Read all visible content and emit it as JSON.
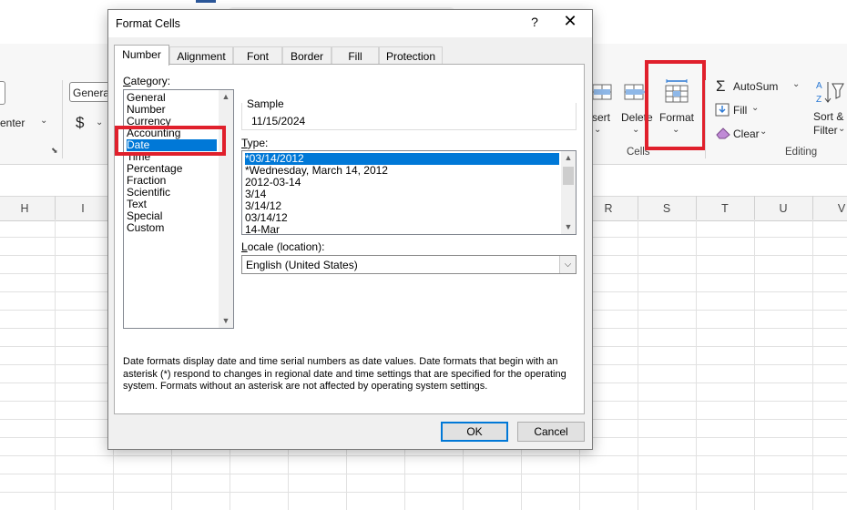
{
  "ribbon": {
    "font_dropdown_value": "Genera",
    "center_label": "enter",
    "currency_symbol": "$",
    "insert_label": "sert",
    "delete_label": "Delete",
    "format_label": "Format",
    "cells_group_label": "Cells",
    "autosum_label": "AutoSum",
    "fill_label": "Fill",
    "clear_label": "Clear",
    "sort_filter_line1": "Sort &",
    "sort_filter_line2": "Filter",
    "editing_group_label": "Editing",
    "partial_o": "o"
  },
  "columns": {
    "left": [
      "H",
      "I"
    ],
    "right": [
      "R",
      "S",
      "T",
      "U",
      "V"
    ]
  },
  "dialog": {
    "title": "Format Cells",
    "help_glyph": "?",
    "close_glyph": "✕",
    "tabs": [
      "Number",
      "Alignment",
      "Font",
      "Border",
      "Fill",
      "Protection"
    ],
    "active_tab": "Number",
    "category_label_accel": "C",
    "category_label_rest": "ategory:",
    "categories": [
      "General",
      "Number",
      "Currency",
      "Accounting",
      "Date",
      "Time",
      "Percentage",
      "Fraction",
      "Scientific",
      "Text",
      "Special",
      "Custom"
    ],
    "selected_category": "Date",
    "sample_label": "Sample",
    "sample_value": "11/15/2024",
    "type_label_accel": "T",
    "type_label_rest": "ype:",
    "types": [
      "*03/14/2012",
      "*Wednesday, March 14, 2012",
      "2012-03-14",
      "3/14",
      "3/14/12",
      "03/14/12",
      "14-Mar"
    ],
    "selected_type": "*03/14/2012",
    "locale_label_accel": "L",
    "locale_label_rest": "ocale (location):",
    "locale_value": "English (United States)",
    "description": "Date formats display date and time serial numbers as date values.  Date formats that begin with an asterisk (*) respond to changes in regional date and time settings that are specified for the operating system. Formats without an asterisk are not affected by operating system settings.",
    "ok_label": "OK",
    "cancel_label": "Cancel"
  }
}
